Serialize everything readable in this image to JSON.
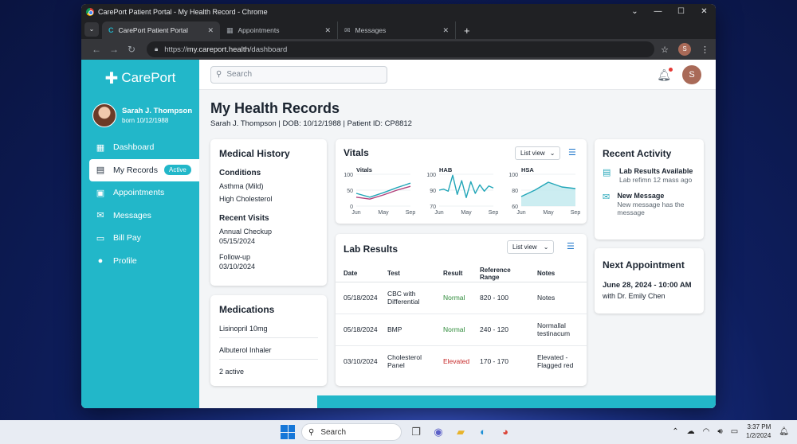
{
  "browser": {
    "window_title": "CarePort Patient Portal - My Health Record - Chrome",
    "tabs": [
      {
        "label": "CarePort Patient Portal",
        "active": true
      },
      {
        "label": "Appointments",
        "active": false
      },
      {
        "label": "Messages",
        "active": false
      }
    ],
    "url_scheme": "https://",
    "url_host": "my.careport.health",
    "url_path": "/dashboard",
    "profile_initial": "S"
  },
  "app": {
    "brand": "CarePort",
    "user": {
      "name": "Sarah J. Thompson",
      "born": "born 10/12/1988"
    },
    "nav": [
      {
        "label": "Dashboard",
        "icon": "dashboard-icon"
      },
      {
        "label": "My Records",
        "icon": "document-icon",
        "badge": "Active",
        "active": true
      },
      {
        "label": "Appointments",
        "icon": "calendar-icon"
      },
      {
        "label": "Messages",
        "icon": "mail-icon"
      },
      {
        "label": "Bill Pay",
        "icon": "credit-card-icon"
      },
      {
        "label": "Profile",
        "icon": "person-icon"
      }
    ],
    "search_placeholder": "Search",
    "notification_dot_color": "#e53935",
    "avatar_initial": "S",
    "accent_color": "#22b7c9"
  },
  "page": {
    "title": "My Health Records",
    "subtitle": "Sarah J. Thompson  |  DOB: 10/12/1988  |  Patient ID: CP8812"
  },
  "medical_history": {
    "title": "Medical History",
    "conditions_title": "Conditions",
    "conditions": [
      "Asthma (Mild)",
      "High Cholesterol"
    ],
    "visits_title": "Recent Visits",
    "visits": [
      {
        "name": "Annual Checkup",
        "date": "05/15/2024"
      },
      {
        "name": "Follow-up",
        "date": "03/10/2024"
      }
    ]
  },
  "medications": {
    "title": "Medications",
    "items": [
      "Lisinopril 10mg",
      "Albuterol Inhaler",
      "2 active"
    ]
  },
  "vitals": {
    "title": "Vitals",
    "view_label": "List view",
    "charts": [
      {
        "name": "Vitals",
        "yticks": [
          "100",
          "50",
          "0"
        ],
        "xticks": [
          "Jun",
          "May",
          "Sep"
        ]
      },
      {
        "name": "HAB",
        "yticks": [
          "100",
          "90",
          "70"
        ],
        "xticks": [
          "Jun",
          "May",
          "Sep"
        ]
      },
      {
        "name": "HSA",
        "yticks": [
          "100",
          "80",
          "60"
        ],
        "xticks": [
          "Jun",
          "May",
          "Sep"
        ]
      }
    ]
  },
  "chart_data": [
    {
      "type": "line",
      "title": "Vitals",
      "x": [
        "Jun",
        "",
        "May",
        "",
        "Sep"
      ],
      "ylim": [
        0,
        100
      ],
      "series": [
        {
          "values": [
            40,
            28,
            42,
            58,
            72
          ],
          "color": "#22a6b8"
        },
        {
          "values": [
            28,
            22,
            35,
            50,
            62
          ],
          "color": "#b0407a"
        }
      ]
    },
    {
      "type": "line",
      "title": "HAB",
      "x": [
        "Jun",
        "",
        "",
        "May",
        "",
        "",
        "Sep"
      ],
      "ylim": [
        70,
        100
      ],
      "series": [
        {
          "values": [
            85,
            86,
            84,
            99,
            81,
            94,
            78,
            93,
            82,
            90,
            84,
            89,
            87
          ],
          "color": "#22a6b8"
        }
      ]
    },
    {
      "type": "area",
      "title": "HSA",
      "x": [
        "Jun",
        "",
        "May",
        "",
        "Sep"
      ],
      "ylim": [
        60,
        100
      ],
      "series": [
        {
          "values": [
            72,
            80,
            90,
            84,
            82
          ],
          "color": "#22a6b8"
        }
      ]
    }
  ],
  "lab_results": {
    "title": "Lab Results",
    "view_label": "List view",
    "columns": [
      "Date",
      "Test",
      "Result",
      "Reference Range",
      "Notes"
    ],
    "rows": [
      {
        "date": "05/18/2024",
        "test": "CBC with Differential",
        "result": "Normal",
        "range": "820 - 100",
        "notes": "Notes",
        "status": "normal"
      },
      {
        "date": "05/18/2024",
        "test": "BMP",
        "result": "Normal",
        "range": "240 - 120",
        "notes": "Normallal testinacum",
        "status": "normal"
      },
      {
        "date": "03/10/2024",
        "test": "Cholesterol Panel",
        "result": "Elevated",
        "range": "170 - 170",
        "notes": "Elevated - Flagged red",
        "status": "elevated"
      }
    ]
  },
  "recent_activity": {
    "title": "Recent Activity",
    "items": [
      {
        "icon": "document-icon",
        "title": "Lab Results Available",
        "sub": "Lab refimn 12 mass ago"
      },
      {
        "icon": "mail-icon",
        "title": "New Message",
        "sub": "New message has the message"
      }
    ]
  },
  "next_appointment": {
    "title": "Next Appointment",
    "when": "June 28, 2024 - 10:00 AM",
    "with": "with Dr. Emily Chen"
  },
  "taskbar": {
    "search_label": "Search",
    "time": "3:37 PM",
    "date": "1/2/2024"
  }
}
